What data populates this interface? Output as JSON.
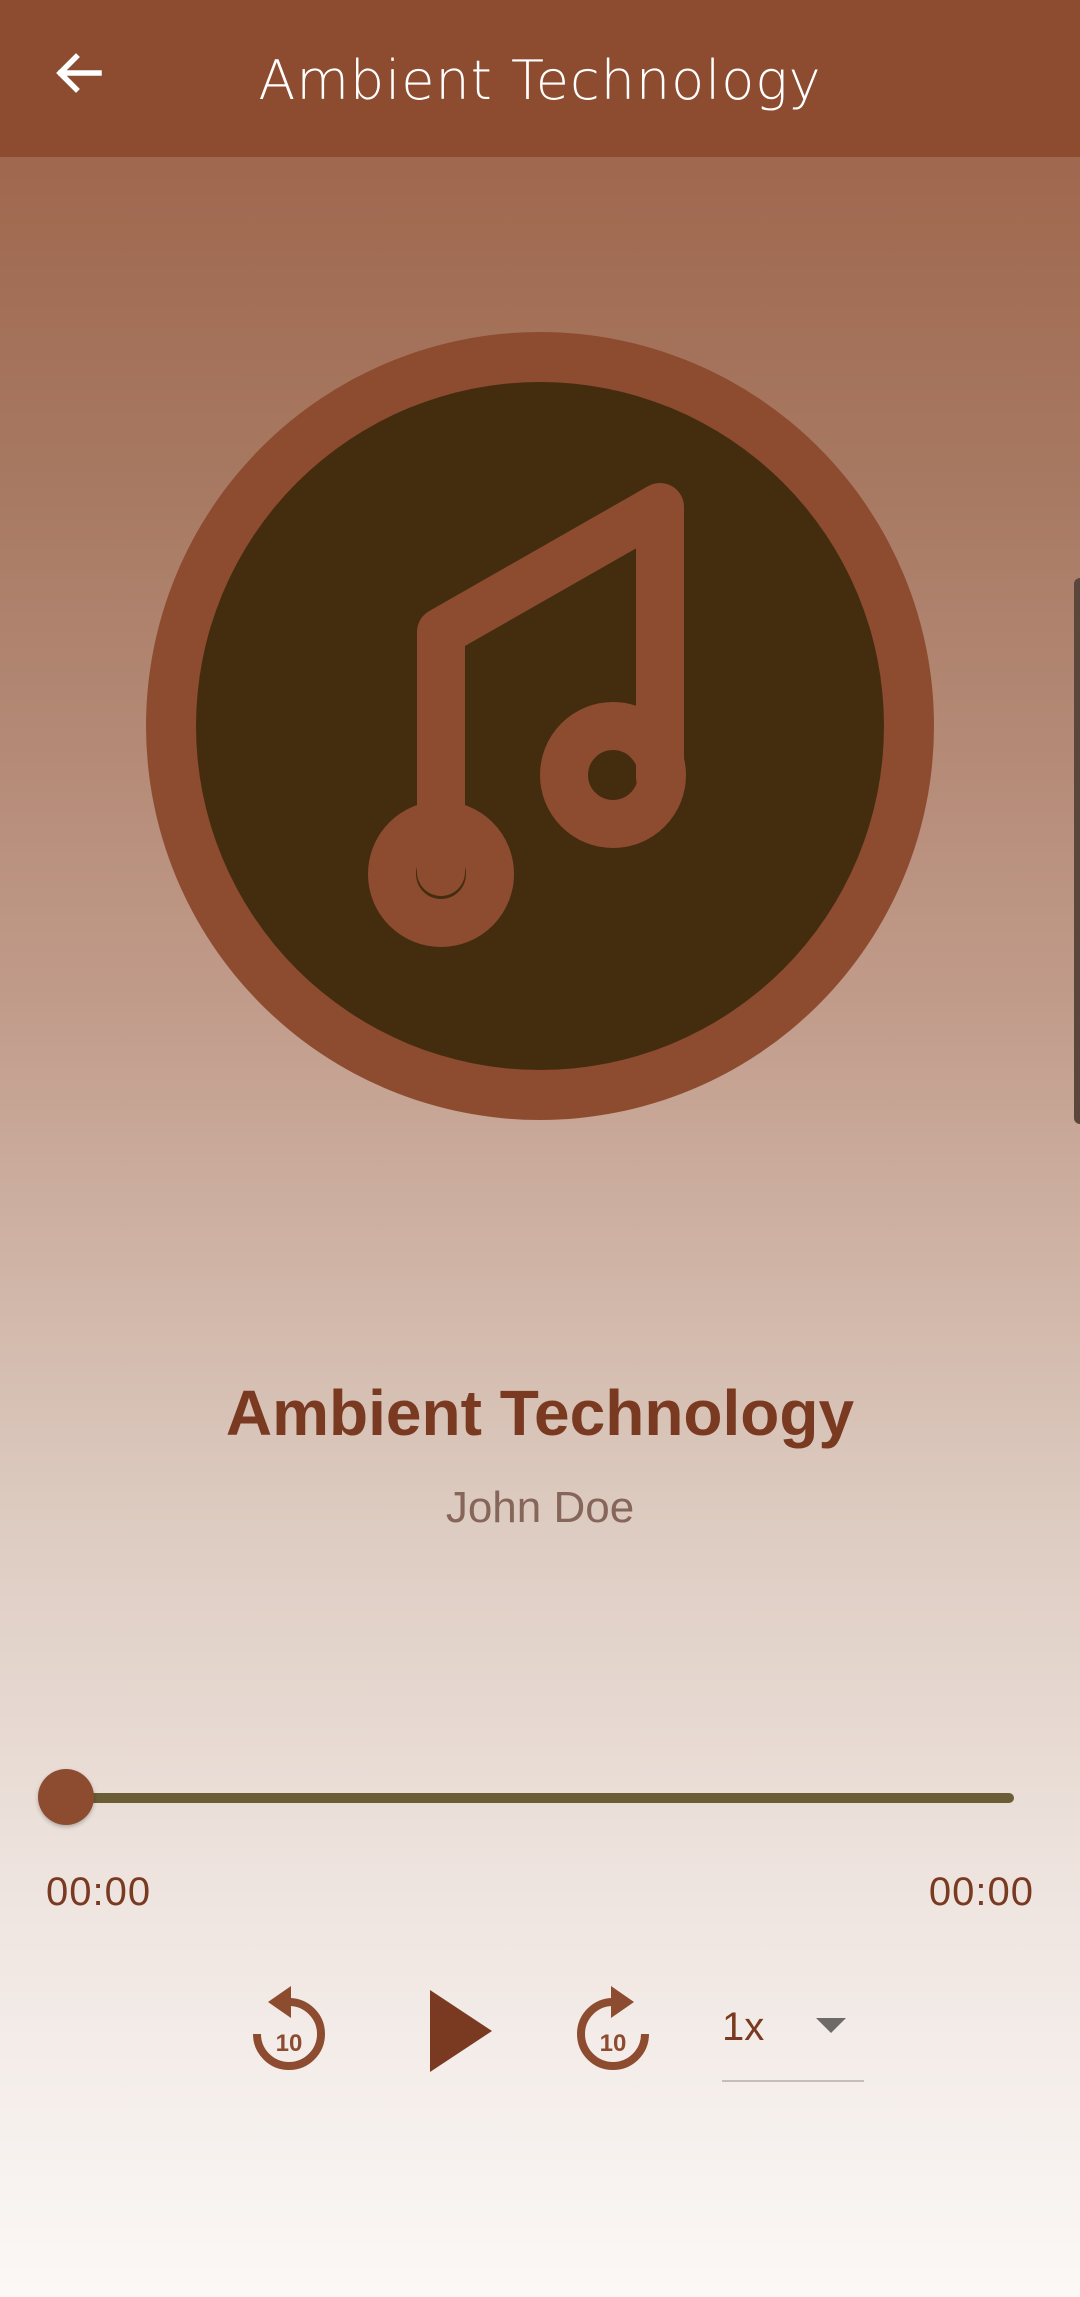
{
  "app_bar": {
    "title": "Ambient Technology",
    "back_icon": "arrow-left-icon"
  },
  "artwork": {
    "icon": "music-note-icon",
    "colors": {
      "ring": "#8d4c30",
      "disc": "#442d0f",
      "note": "#8d4c30"
    }
  },
  "track": {
    "title": "Ambient Technology",
    "artist": "John Doe"
  },
  "progress": {
    "position_fraction": 0.0,
    "current_time": "00:00",
    "total_time": "00:00"
  },
  "controls": {
    "rewind_icon": "replay-10-icon",
    "rewind_label": "10",
    "play_icon": "play-icon",
    "forward_icon": "forward-10-icon",
    "forward_label": "10",
    "speed": {
      "selected": "1x",
      "caret_icon": "caret-down-icon"
    }
  },
  "colors": {
    "app_bar": "#8d4c30",
    "accent": "#7a3a21",
    "track_line": "#6b5e36",
    "subtitle": "#86655a"
  }
}
